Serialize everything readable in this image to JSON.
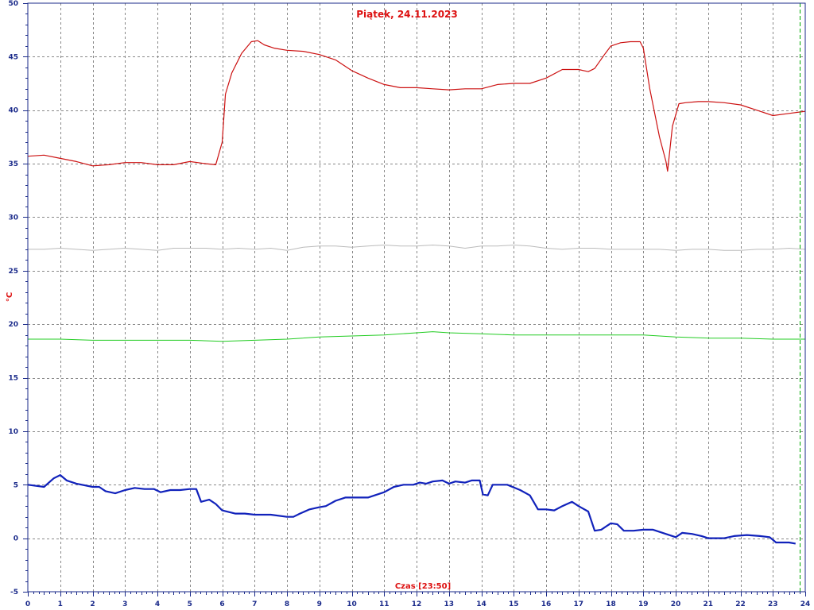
{
  "chart_data": {
    "type": "line",
    "title": "Piątek, 24.11.2023",
    "xlabel": "Czas [23:50]",
    "ylabel": "°C",
    "xlim": [
      0,
      24
    ],
    "ylim": [
      -5,
      50
    ],
    "x_ticks": [
      0,
      1,
      2,
      3,
      4,
      5,
      6,
      7,
      8,
      9,
      10,
      11,
      12,
      13,
      14,
      15,
      16,
      17,
      18,
      19,
      20,
      21,
      22,
      23,
      24
    ],
    "y_ticks": [
      -5,
      0,
      5,
      10,
      15,
      20,
      25,
      30,
      35,
      40,
      45,
      50
    ],
    "grid": true,
    "cursor_x": 23.83,
    "colors": {
      "frame": "#1a2a8a",
      "grid": "#888888",
      "ticks": "#1a2a8a",
      "title": "#dd1111",
      "cursor": "#00aa00"
    },
    "series": [
      {
        "color": "#cc1111",
        "width": 1.2,
        "points": [
          [
            0,
            35.7
          ],
          [
            0.5,
            35.8
          ],
          [
            1,
            35.5
          ],
          [
            1.5,
            35.2
          ],
          [
            2,
            34.8
          ],
          [
            2.5,
            34.9
          ],
          [
            3,
            35.1
          ],
          [
            3.5,
            35.1
          ],
          [
            4,
            34.9
          ],
          [
            4.5,
            34.9
          ],
          [
            5,
            35.2
          ],
          [
            5.5,
            35.0
          ],
          [
            5.8,
            34.9
          ],
          [
            6,
            37.0
          ],
          [
            6.1,
            41.5
          ],
          [
            6.3,
            43.5
          ],
          [
            6.6,
            45.3
          ],
          [
            6.9,
            46.4
          ],
          [
            7.1,
            46.5
          ],
          [
            7.3,
            46.1
          ],
          [
            7.6,
            45.8
          ],
          [
            8,
            45.6
          ],
          [
            8.5,
            45.5
          ],
          [
            9,
            45.2
          ],
          [
            9.5,
            44.7
          ],
          [
            10,
            43.7
          ],
          [
            10.5,
            43.0
          ],
          [
            11,
            42.4
          ],
          [
            11.5,
            42.1
          ],
          [
            12,
            42.1
          ],
          [
            12.5,
            42.0
          ],
          [
            13,
            41.9
          ],
          [
            13.5,
            42.0
          ],
          [
            14,
            42.0
          ],
          [
            14.5,
            42.4
          ],
          [
            15,
            42.5
          ],
          [
            15.5,
            42.5
          ],
          [
            16,
            43.0
          ],
          [
            16.5,
            43.8
          ],
          [
            17,
            43.8
          ],
          [
            17.3,
            43.6
          ],
          [
            17.5,
            43.9
          ],
          [
            17.8,
            45.2
          ],
          [
            18,
            46.0
          ],
          [
            18.3,
            46.3
          ],
          [
            18.6,
            46.4
          ],
          [
            18.9,
            46.4
          ],
          [
            19,
            45.8
          ],
          [
            19.2,
            42.0
          ],
          [
            19.5,
            37.5
          ],
          [
            19.7,
            35.2
          ],
          [
            19.75,
            34.3
          ],
          [
            19.9,
            38.5
          ],
          [
            20.1,
            40.6
          ],
          [
            20.3,
            40.7
          ],
          [
            20.7,
            40.8
          ],
          [
            21,
            40.8
          ],
          [
            21.5,
            40.7
          ],
          [
            22,
            40.5
          ],
          [
            22.5,
            40.0
          ],
          [
            23,
            39.5
          ],
          [
            23.5,
            39.7
          ],
          [
            24,
            39.9
          ]
        ]
      },
      {
        "color": "#bbbbbb",
        "width": 1.0,
        "points": [
          [
            0,
            27.0
          ],
          [
            0.5,
            27.0
          ],
          [
            1,
            27.1
          ],
          [
            1.5,
            27.0
          ],
          [
            2,
            26.9
          ],
          [
            2.5,
            27.0
          ],
          [
            3,
            27.1
          ],
          [
            3.5,
            27.0
          ],
          [
            4,
            26.9
          ],
          [
            4.5,
            27.1
          ],
          [
            5,
            27.1
          ],
          [
            5.5,
            27.1
          ],
          [
            6,
            27.0
          ],
          [
            6.5,
            27.1
          ],
          [
            7,
            27.0
          ],
          [
            7.5,
            27.1
          ],
          [
            8,
            26.9
          ],
          [
            8.5,
            27.2
          ],
          [
            9,
            27.3
          ],
          [
            9.5,
            27.3
          ],
          [
            10,
            27.2
          ],
          [
            10.5,
            27.3
          ],
          [
            11,
            27.4
          ],
          [
            11.5,
            27.3
          ],
          [
            12,
            27.3
          ],
          [
            12.5,
            27.4
          ],
          [
            13,
            27.3
          ],
          [
            13.5,
            27.1
          ],
          [
            14,
            27.3
          ],
          [
            14.5,
            27.3
          ],
          [
            15,
            27.4
          ],
          [
            15.5,
            27.3
          ],
          [
            16,
            27.1
          ],
          [
            16.5,
            27.0
          ],
          [
            17,
            27.1
          ],
          [
            17.5,
            27.1
          ],
          [
            18,
            27.0
          ],
          [
            18.5,
            27.0
          ],
          [
            19,
            27.0
          ],
          [
            19.5,
            27.0
          ],
          [
            20,
            26.9
          ],
          [
            20.5,
            27.0
          ],
          [
            21,
            27.0
          ],
          [
            21.5,
            26.9
          ],
          [
            22,
            26.9
          ],
          [
            22.5,
            27.0
          ],
          [
            23,
            27.0
          ],
          [
            23.5,
            27.1
          ],
          [
            24,
            27.0
          ]
        ]
      },
      {
        "color": "#22cc22",
        "width": 1.0,
        "points": [
          [
            0,
            18.6
          ],
          [
            1,
            18.6
          ],
          [
            2,
            18.5
          ],
          [
            3,
            18.5
          ],
          [
            4,
            18.5
          ],
          [
            5,
            18.5
          ],
          [
            6,
            18.4
          ],
          [
            7,
            18.5
          ],
          [
            8,
            18.6
          ],
          [
            9,
            18.8
          ],
          [
            10,
            18.9
          ],
          [
            11,
            19.0
          ],
          [
            12,
            19.2
          ],
          [
            12.5,
            19.3
          ],
          [
            13,
            19.2
          ],
          [
            14,
            19.1
          ],
          [
            15,
            19.0
          ],
          [
            16,
            19.0
          ],
          [
            17,
            19.0
          ],
          [
            18,
            19.0
          ],
          [
            19,
            19.0
          ],
          [
            20,
            18.8
          ],
          [
            21,
            18.7
          ],
          [
            22,
            18.7
          ],
          [
            23,
            18.6
          ],
          [
            24,
            18.6
          ]
        ]
      },
      {
        "color": "#1122bb",
        "width": 2.2,
        "points": [
          [
            0,
            5.0
          ],
          [
            0.5,
            4.8
          ],
          [
            0.8,
            5.6
          ],
          [
            1,
            5.9
          ],
          [
            1.2,
            5.4
          ],
          [
            1.5,
            5.1
          ],
          [
            2,
            4.8
          ],
          [
            2.2,
            4.8
          ],
          [
            2.4,
            4.4
          ],
          [
            2.7,
            4.2
          ],
          [
            3,
            4.5
          ],
          [
            3.3,
            4.7
          ],
          [
            3.6,
            4.6
          ],
          [
            3.9,
            4.6
          ],
          [
            4.1,
            4.3
          ],
          [
            4.4,
            4.5
          ],
          [
            4.7,
            4.5
          ],
          [
            5,
            4.6
          ],
          [
            5.2,
            4.6
          ],
          [
            5.35,
            3.4
          ],
          [
            5.6,
            3.6
          ],
          [
            5.8,
            3.2
          ],
          [
            6,
            2.6
          ],
          [
            6.4,
            2.3
          ],
          [
            6.7,
            2.3
          ],
          [
            7,
            2.2
          ],
          [
            7.5,
            2.2
          ],
          [
            8,
            2.0
          ],
          [
            8.2,
            2.0
          ],
          [
            8.4,
            2.3
          ],
          [
            8.7,
            2.7
          ],
          [
            9,
            2.9
          ],
          [
            9.2,
            3.0
          ],
          [
            9.5,
            3.5
          ],
          [
            9.8,
            3.8
          ],
          [
            10,
            3.8
          ],
          [
            10.5,
            3.8
          ],
          [
            11,
            4.3
          ],
          [
            11.3,
            4.8
          ],
          [
            11.6,
            5.0
          ],
          [
            11.9,
            5.0
          ],
          [
            12.1,
            5.2
          ],
          [
            12.3,
            5.1
          ],
          [
            12.5,
            5.3
          ],
          [
            12.8,
            5.4
          ],
          [
            13.0,
            5.1
          ],
          [
            13.2,
            5.3
          ],
          [
            13.5,
            5.2
          ],
          [
            13.7,
            5.4
          ],
          [
            13.95,
            5.4
          ],
          [
            14.05,
            4.1
          ],
          [
            14.2,
            4.0
          ],
          [
            14.35,
            5.0
          ],
          [
            14.8,
            5.0
          ],
          [
            15.2,
            4.5
          ],
          [
            15.5,
            4.0
          ],
          [
            15.75,
            2.7
          ],
          [
            16,
            2.7
          ],
          [
            16.25,
            2.6
          ],
          [
            16.5,
            3.0
          ],
          [
            16.8,
            3.4
          ],
          [
            17,
            3.0
          ],
          [
            17.3,
            2.5
          ],
          [
            17.5,
            0.7
          ],
          [
            17.7,
            0.8
          ],
          [
            18,
            1.4
          ],
          [
            18.2,
            1.3
          ],
          [
            18.4,
            0.7
          ],
          [
            18.7,
            0.7
          ],
          [
            19,
            0.8
          ],
          [
            19.3,
            0.8
          ],
          [
            19.6,
            0.5
          ],
          [
            19.9,
            0.2
          ],
          [
            20.0,
            0.1
          ],
          [
            20.2,
            0.5
          ],
          [
            20.5,
            0.4
          ],
          [
            20.8,
            0.2
          ],
          [
            21,
            0.0
          ],
          [
            21.5,
            0.0
          ],
          [
            21.8,
            0.2
          ],
          [
            22.2,
            0.3
          ],
          [
            22.6,
            0.2
          ],
          [
            22.9,
            0.1
          ],
          [
            23.1,
            -0.4
          ],
          [
            23.5,
            -0.4
          ],
          [
            23.7,
            -0.5
          ]
        ]
      }
    ]
  }
}
